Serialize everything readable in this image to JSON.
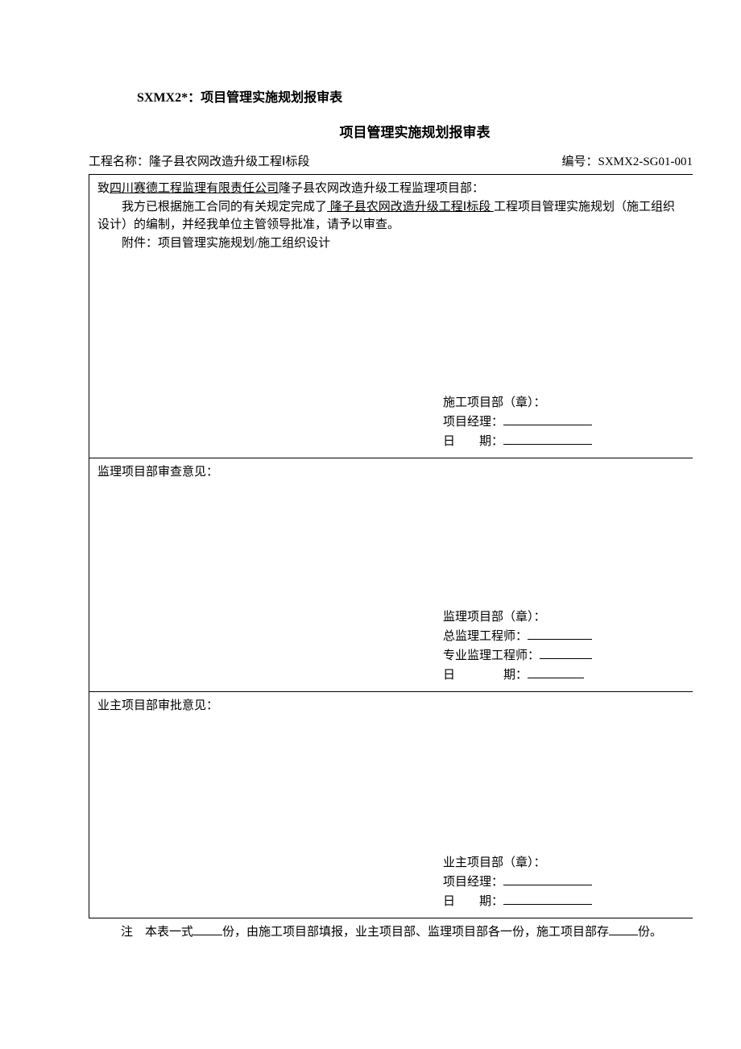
{
  "doc": {
    "code_line": "SXMX2*：项目管理实施规划报审表",
    "title": "项目管理实施规划报审表",
    "project_label": "工程名称：",
    "project_name": "隆子县农网改造升级工程Ⅰ标段",
    "number_label": "编号：",
    "number_value": "SXMX2-SG01-001"
  },
  "section1": {
    "to_prefix": "致",
    "to_company": "四川赛德工程监理有限责任公司",
    "to_suffix": "隆子县农网改造升级工程监理项目部：",
    "body_pre": "我方已根据施工合同的有关规定完成了",
    "body_underline": " 隆子县农网改造升级工程Ⅰ标段  ",
    "body_post": "工程项目管理实施规划（施工组织设计）的编制，并经我单位主管领导批准，请予以审查。",
    "attachment": "附件：项目管理实施规划/施工组织设计",
    "sig": {
      "dept": "施工项目部（章）：",
      "manager": "项目经理：",
      "date_label": "日　　期："
    }
  },
  "section2": {
    "heading": "监理项目部审查意见：",
    "sig": {
      "dept": "监理项目部（章）：",
      "chief": "总监理工程师：",
      "spec": "专业监理工程师：",
      "date_label": "日　　　　期："
    }
  },
  "section3": {
    "heading": "业主项目部审批意见：",
    "sig": {
      "dept": "业主项目部（章）：",
      "manager": "项目经理：",
      "date_label": "日　　期："
    }
  },
  "note": {
    "prefix": "注　本表一式",
    "mid": "份，由施工项目部填报，业主项目部、监理项目部各一份，施工项目部存",
    "suffix": "份。"
  }
}
